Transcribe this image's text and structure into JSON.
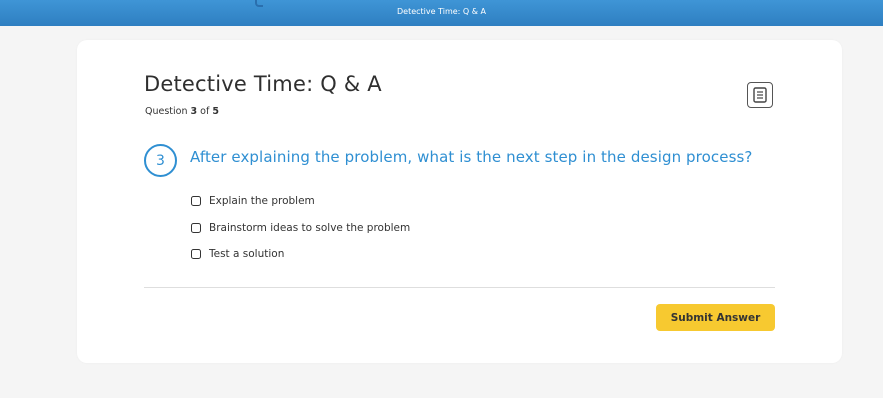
{
  "header": {
    "title": "Detective Time: Q & A"
  },
  "quiz": {
    "title": "Detective Time: Q & A",
    "progress": {
      "prefix": "Question ",
      "current": "3",
      "separator": " of ",
      "total": "5"
    },
    "notes_icon": "notes-icon",
    "question": {
      "number": "3",
      "text": "After explaining the problem, what is the next step in the design process?",
      "options": [
        {
          "label": "Explain the problem",
          "checked": false
        },
        {
          "label": "Brainstorm ideas to solve the problem",
          "checked": false
        },
        {
          "label": "Test a solution",
          "checked": false
        }
      ]
    },
    "submit_label": "Submit Answer"
  },
  "colors": {
    "header_blue": "#2e7fc1",
    "accent_blue": "#2f8fd2",
    "submit_yellow": "#f7c930"
  }
}
